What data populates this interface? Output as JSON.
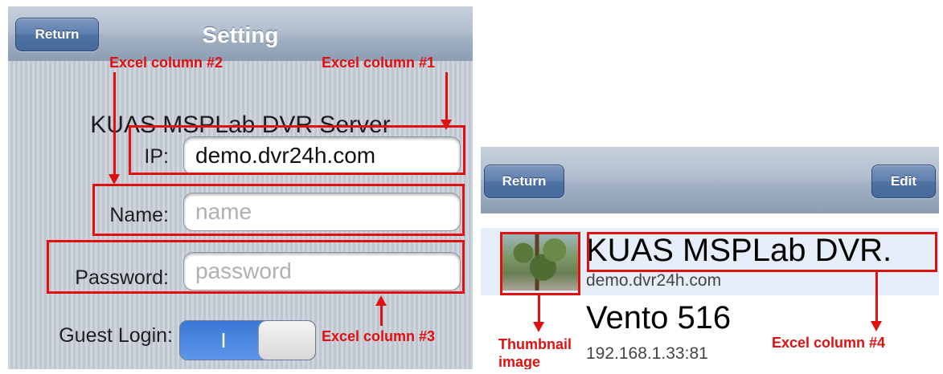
{
  "settings_screen": {
    "nav": {
      "back_label": "Return",
      "title": "Setting"
    },
    "server_name": "KUAS MSPLab DVR Server",
    "fields": {
      "ip": {
        "label": "IP:",
        "value": "demo.dvr24h.com"
      },
      "name": {
        "label": "Name:",
        "placeholder": "name"
      },
      "password": {
        "label": "Password:",
        "placeholder": "password"
      }
    },
    "guest_login": {
      "label": "Guest Login:",
      "toggle_text": "I",
      "state": "on"
    }
  },
  "list_screen": {
    "nav": {
      "back_label": "Return",
      "edit_label": "Edit"
    },
    "rows": [
      {
        "title": "KUAS MSPLab DVR.",
        "subtitle": "demo.dvr24h.com"
      },
      {
        "title": "Vento 516",
        "subtitle": "192.168.1.33:81"
      }
    ]
  },
  "annotations": {
    "col1": "Excel column #1",
    "col2": "Excel column #2",
    "col3": "Excel column #3",
    "col4": "Excel column #4",
    "thumb_line1": "Thumbnail",
    "thumb_line2": "image"
  },
  "colors": {
    "annotation_red": "#e01010",
    "ios_nav_blue": "#5f7fae",
    "toggle_blue": "#3a77d6"
  }
}
